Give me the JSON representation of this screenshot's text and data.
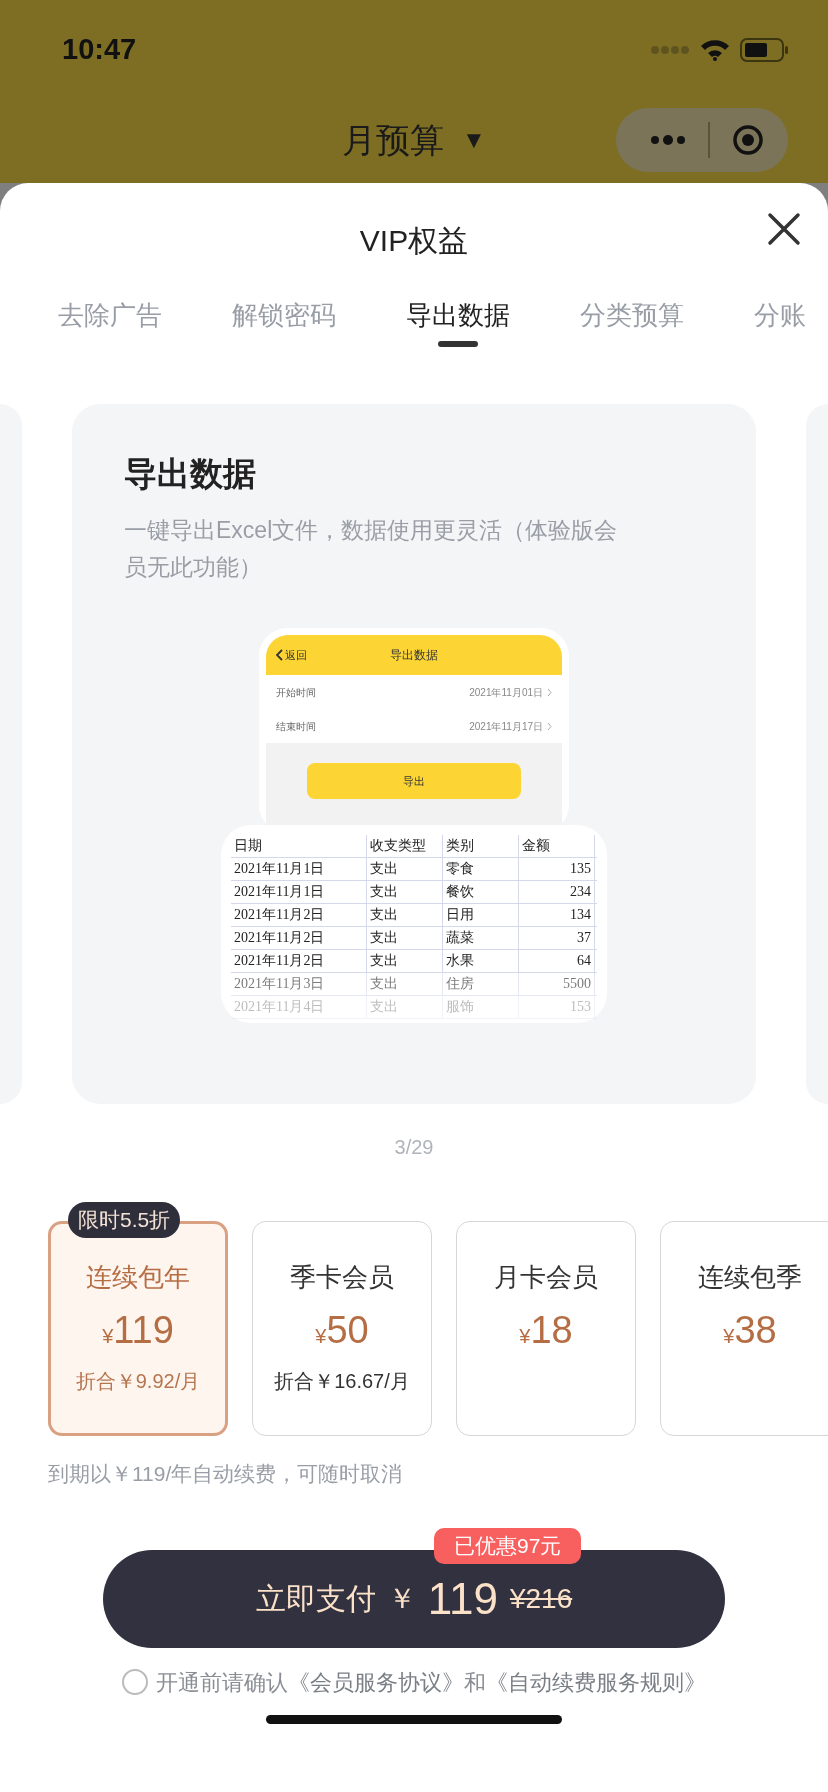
{
  "status_bar": {
    "time": "10:47"
  },
  "nav": {
    "title": "月预算",
    "caret": "▼"
  },
  "sheet": {
    "title": "VIP权益"
  },
  "tabs": [
    {
      "label": "去除广告",
      "selected": false
    },
    {
      "label": "解锁密码",
      "selected": false
    },
    {
      "label": "导出数据",
      "selected": true
    },
    {
      "label": "分类预算",
      "selected": false
    },
    {
      "label": "分账",
      "selected": false
    }
  ],
  "feature": {
    "title": "导出数据",
    "description": "一键导出Excel文件，数据使用更灵活（体验版会员无此功能）",
    "mock_app": {
      "back": "返回",
      "title": "导出数据",
      "rows": [
        {
          "label": "开始时间",
          "value": "2021年11月01日"
        },
        {
          "label": "结束时间",
          "value": "2021年11月17日"
        }
      ],
      "button": "导出"
    },
    "sheet_table": {
      "columns": [
        "日期",
        "收支类型",
        "类别",
        "金额"
      ],
      "rows": [
        [
          "2021年11月1日",
          "支出",
          "零食",
          "135"
        ],
        [
          "2021年11月1日",
          "支出",
          "餐饮",
          "234"
        ],
        [
          "2021年11月2日",
          "支出",
          "日用",
          "134"
        ],
        [
          "2021年11月2日",
          "支出",
          "蔬菜",
          "37"
        ],
        [
          "2021年11月2日",
          "支出",
          "水果",
          "64"
        ],
        [
          "2021年11月3日",
          "支出",
          "住房",
          "5500"
        ],
        [
          "2021年11月4日",
          "支出",
          "服饰",
          "153"
        ]
      ]
    }
  },
  "pager": "3/29",
  "plans": [
    {
      "name": "连续包年",
      "currency": "¥",
      "amount": "119",
      "per_month": "折合￥9.92/月",
      "badge": "限时5.5折",
      "selected": true
    },
    {
      "name": "季卡会员",
      "currency": "¥",
      "amount": "50",
      "per_month": "折合￥16.67/月",
      "selected": false
    },
    {
      "name": "月卡会员",
      "currency": "¥",
      "amount": "18",
      "selected": false
    },
    {
      "name": "连续包季",
      "currency": "¥",
      "amount": "38",
      "selected": false
    }
  ],
  "renew_note": "到期以￥119/年自动续费，可随时取消",
  "pay": {
    "label": "立即支付",
    "currency": "￥",
    "amount": "119",
    "original": "¥216",
    "discount": "已优惠97元"
  },
  "agreement": {
    "checked": false,
    "parts": [
      {
        "kind": "text",
        "text": "开通前请确认"
      },
      {
        "kind": "link",
        "text": "《会员服务协议》"
      },
      {
        "kind": "text",
        "text": "和"
      },
      {
        "kind": "link",
        "text": "《自动续费服务规则》"
      }
    ]
  }
}
